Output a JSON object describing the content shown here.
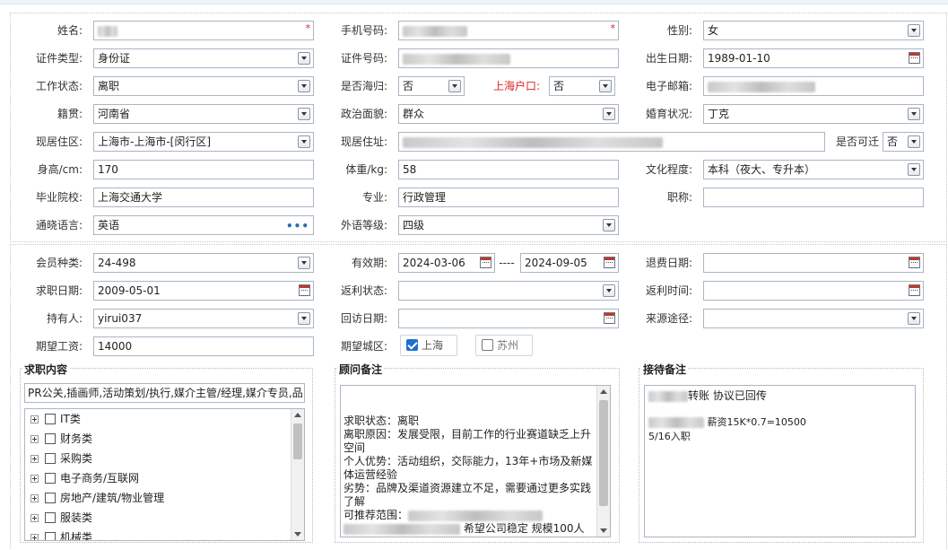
{
  "basic": {
    "name_label": "姓名:",
    "phone_label": "手机号码:",
    "gender_label": "性别:",
    "gender_value": "女",
    "idtype_label": "证件类型:",
    "idtype_value": "身份证",
    "idno_label": "证件号码:",
    "birth_label": "出生日期:",
    "birth_value": "1989-01-10",
    "workstatus_label": "工作状态:",
    "workstatus_value": "离职",
    "returnee_label": "是否海归:",
    "returnee_value": "否",
    "hukou_label": "上海户口:",
    "hukou_value": "否",
    "email_label": "电子邮箱:",
    "native_label": "籍贯:",
    "native_value": "河南省",
    "political_label": "政治面貌:",
    "political_value": "群众",
    "marital_label": "婚育状况:",
    "marital_value": "丁克",
    "residence_label": "现居住区:",
    "residence_value": "上海市-上海市-[闵行区]",
    "address_label": "现居住址:",
    "relocate_label": "是否可迁",
    "relocate_value": "否",
    "height_label": "身高/cm:",
    "height_value": "170",
    "weight_label": "体重/kg:",
    "weight_value": "58",
    "edu_label": "文化程度:",
    "edu_value": "本科（夜大、专升本）",
    "school_label": "毕业院校:",
    "school_value": "上海交通大学",
    "major_label": "专业:",
    "major_value": "行政管理",
    "title_label": "职称:",
    "title_value": "",
    "lang_label": "通晓语言:",
    "lang_value": "英语",
    "foreign_label": "外语等级:",
    "foreign_value": "四级"
  },
  "member": {
    "type_label": "会员种类:",
    "type_value": "24-498",
    "valid_label": "有效期:",
    "valid_from": "2024-03-06",
    "valid_sep": "----",
    "valid_to": "2024-09-05",
    "refund_label": "退费日期:",
    "refund_value": "",
    "jobdate_label": "求职日期:",
    "jobdate_value": "2009-05-01",
    "rebate_status_label": "返利状态:",
    "rebate_status_value": "",
    "rebate_time_label": "返利时间:",
    "rebate_time_value": "",
    "holder_label": "持有人:",
    "holder_value": "yirui037",
    "visit_label": "回访日期:",
    "visit_value": "",
    "source_label": "来源途径:",
    "source_value": "",
    "salary_label": "期望工资:",
    "salary_value": "14000",
    "city_label": "期望城区:",
    "city_options": [
      {
        "label": "上海",
        "checked": true
      },
      {
        "label": "苏州",
        "checked": false
      }
    ]
  },
  "job_panel": {
    "title": "求职内容",
    "summary": "PR公关,插画师,活动策划/执行,媒介主管/经理,媒介专员,品",
    "tree": [
      "IT类",
      "财务类",
      "采购类",
      "电子商务/互联网",
      "房地产/建筑/物业管理",
      "服装类",
      "机械类"
    ]
  },
  "advisor_panel": {
    "title": "顾问备注",
    "lines": [
      "求职状态：离职",
      "离职原因：发展受限，目前工作的行业赛道缺乏上升空间",
      "个人优势：活动组织，交际能力，13年+市场及新媒体运营经验",
      "劣势：品牌及渠道资源建立不足，需要通过更多实践了解",
      "可推荐范围："
    ],
    "tail": "希望公司稳定 规模100人"
  },
  "reception_panel": {
    "title": "接待备注",
    "line1_suffix": "转账 协议已回传",
    "line2_suffix": "薪资15K*0.7=10500",
    "line3": "5/16入职"
  },
  "colors": {
    "border": "#a9b6c4",
    "required": "#dd2222",
    "checkbox_on": "#1e6fd0"
  }
}
